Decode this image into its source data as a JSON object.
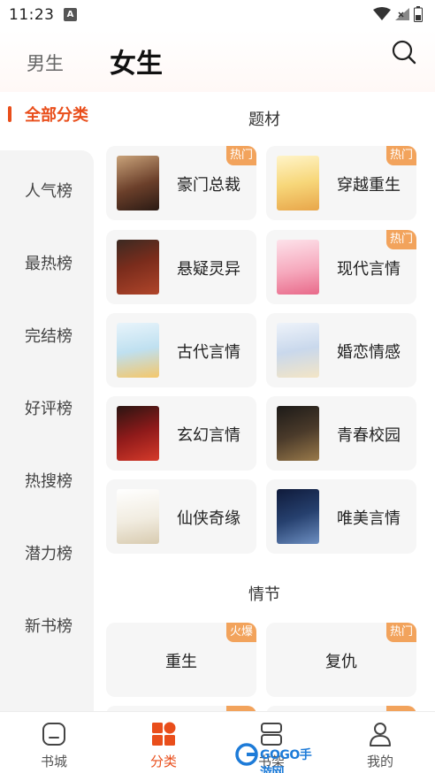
{
  "status_bar": {
    "time": "11:23",
    "notification_glyph": "A"
  },
  "header": {
    "tab_male": "男生",
    "tab_female": "女生",
    "search_icon": "search-icon"
  },
  "sidebar": {
    "active": "全部分类",
    "items": [
      {
        "label": "人气榜"
      },
      {
        "label": "最热榜"
      },
      {
        "label": "完结榜"
      },
      {
        "label": "好评榜"
      },
      {
        "label": "热搜榜"
      },
      {
        "label": "潜力榜"
      },
      {
        "label": "新书榜"
      }
    ]
  },
  "themes": {
    "title": "题材",
    "items": [
      {
        "label": "豪门总裁",
        "badge": "热门"
      },
      {
        "label": "穿越重生",
        "badge": "热门"
      },
      {
        "label": "悬疑灵异",
        "badge": ""
      },
      {
        "label": "现代言情",
        "badge": "热门"
      },
      {
        "label": "古代言情",
        "badge": ""
      },
      {
        "label": "婚恋情感",
        "badge": ""
      },
      {
        "label": "玄幻言情",
        "badge": ""
      },
      {
        "label": "青春校园",
        "badge": ""
      },
      {
        "label": "仙侠奇缘",
        "badge": ""
      },
      {
        "label": "唯美言情",
        "badge": ""
      }
    ]
  },
  "plots": {
    "title": "情节",
    "items": [
      {
        "label": "重生",
        "badge": "火爆"
      },
      {
        "label": "复仇",
        "badge": "热门"
      }
    ]
  },
  "bottom_nav": {
    "items": [
      {
        "label": "书城",
        "icon": "bookstore-icon"
      },
      {
        "label": "分类",
        "icon": "category-grid-icon"
      },
      {
        "label": "书架",
        "icon": "bookshelf-icon"
      },
      {
        "label": "我的",
        "icon": "profile-icon"
      }
    ],
    "active_index": 1
  },
  "watermark": {
    "text": "GOGO手游网"
  },
  "colors": {
    "accent": "#e94e1b",
    "badge": "#f2a35c",
    "card_bg": "#f6f6f6",
    "sidebar_bg": "#f4f4f4"
  }
}
